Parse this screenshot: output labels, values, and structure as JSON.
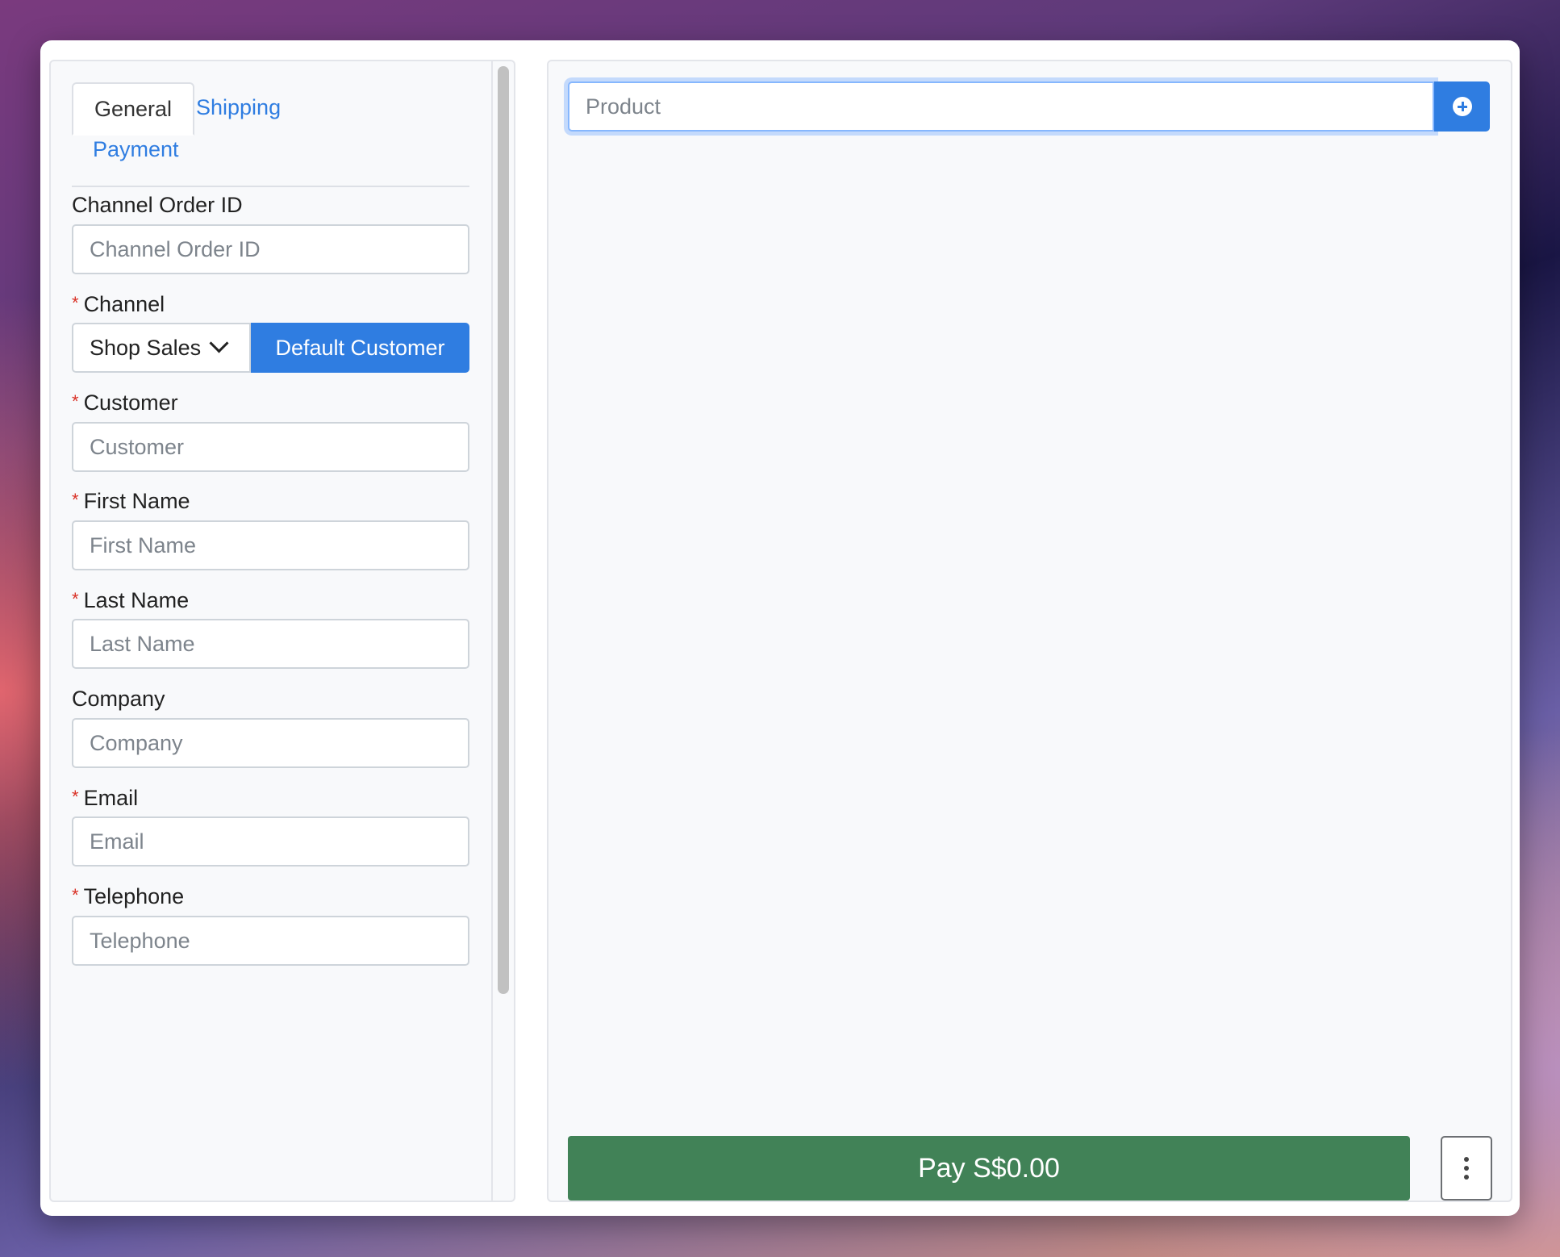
{
  "tabs": {
    "general": "General",
    "shipping": "Shipping",
    "payment": "Payment"
  },
  "form": {
    "channel_order_id": {
      "label": "Channel Order ID",
      "placeholder": "Channel Order ID"
    },
    "channel": {
      "label": "Channel",
      "selected": "Shop Sales",
      "default_customer_button": "Default Customer",
      "required_mark": "*"
    },
    "customer": {
      "label": "Customer",
      "placeholder": "Customer",
      "required_mark": "*"
    },
    "first_name": {
      "label": "First Name",
      "placeholder": "First Name",
      "required_mark": "*"
    },
    "last_name": {
      "label": "Last Name",
      "placeholder": "Last Name",
      "required_mark": "*"
    },
    "company": {
      "label": "Company",
      "placeholder": "Company"
    },
    "email": {
      "label": "Email",
      "placeholder": "Email",
      "required_mark": "*"
    },
    "telephone": {
      "label": "Telephone",
      "placeholder": "Telephone",
      "required_mark": "*"
    }
  },
  "cart": {
    "product_placeholder": "Product",
    "add_icon": "plus-circle-icon",
    "pay_label": "Pay S$0.00",
    "more_icon": "vertical-ellipsis-icon"
  },
  "colors": {
    "primary": "#2f7de1",
    "pay": "#418257",
    "required": "#d93025"
  }
}
